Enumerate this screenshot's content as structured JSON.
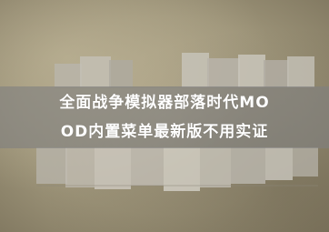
{
  "caption": {
    "line1": "全面战争模拟器部落时代MO",
    "line2": "OD内置菜单最新版不用实证"
  },
  "colors": {
    "band": "#808080",
    "text": "#ffffff"
  }
}
